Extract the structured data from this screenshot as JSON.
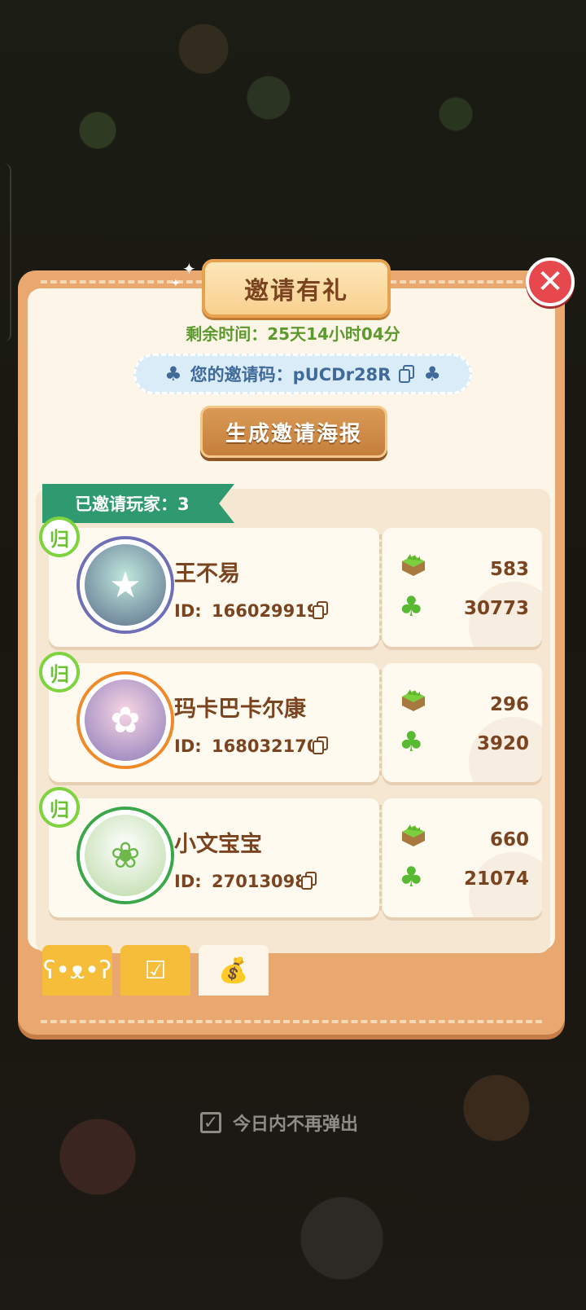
{
  "dialog": {
    "title": "邀请有礼",
    "remaining_time": "剩余时间：25天14小时04分",
    "invite_code_label": "您的邀请码：pUCDr28R",
    "generate_poster_label": "生成邀请海报",
    "invited_count_label": "已邀请玩家：3",
    "badge_text": "归",
    "id_prefix": "ID:"
  },
  "players": [
    {
      "name": "王不易",
      "id": "166029919",
      "grass": "583",
      "clover": "30773",
      "ring_color": "#6f6fb8"
    },
    {
      "name": "玛卡巴卡尔康",
      "id": "168032170",
      "grass": "296",
      "clover": "3920",
      "ring_color": "#f08a28"
    },
    {
      "name": "小文宝宝",
      "id": "27013098",
      "grass": "660",
      "clover": "21074",
      "ring_color": "#3aa84a"
    }
  ],
  "tabs": [
    {
      "icon": "bear-face-icon"
    },
    {
      "icon": "checklist-icon"
    },
    {
      "icon": "money-bag-icon"
    }
  ],
  "footer": {
    "dont_show_today": "今日内不再弹出"
  },
  "colors": {
    "accent_green": "#5c9a2e",
    "panel": "#e8a870",
    "text_brown": "#7b4420"
  }
}
